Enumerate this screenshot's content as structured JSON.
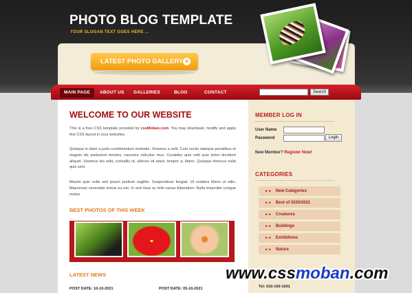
{
  "header": {
    "title": "PHOTO BLOG TEMPLATE",
    "slogan": "YOUR SLOGAN TEXT GOES HERE ..."
  },
  "banner": {
    "gallery_button": "LATEST PHOTO GALLERY"
  },
  "nav": {
    "items": [
      "MAIN PAGE",
      "ABOUT US",
      "GALLERIES",
      "BLOG",
      "CONTACT"
    ],
    "active_index": 0
  },
  "search": {
    "value": "",
    "button": "Search"
  },
  "main": {
    "welcome_title": "WELCOME TO OUR WEBSITE",
    "intro_before": "This is a free CSS template provided by ",
    "intro_link": "cssMoban.com",
    "intro_after": ". You may download, modify and apply this CSS layout in your websites.",
    "para2": "Quisque in diam a justo condimentum molestie. Vivamus a velit. Cum sociis natoque penatibus et magnis dis parturient montes, nascetur ridiculus mus. Curabitur quis velit quis tortor tincidunt aliquet. Vivamus leo velit, convallis id, ultrices sit amet, tempor a, libero. Quisque rhoncus nulla quis sem.",
    "para3": "Mauris quis nulla sed ipsum pretium sagittis. Suspendisse feugiat. Ut sodales libero ut odio. Maecenas venenatis metus eu est. In sed risus ac felis varius bibendum. Nulla imperdiet congue metus.",
    "best_photos_title": "BEST PHOTOS OF THIS WEEK",
    "latest_news_title": "LATEST NEWS",
    "news_dates": [
      "POST DATE: 10-10-2021",
      "POST DATE: 05-10-2021"
    ]
  },
  "sidebar": {
    "login_title": "MEMBER LOG IN",
    "username_label": "User Name",
    "password_label": "Password",
    "login_button": "Login",
    "new_member_text": "New Member? ",
    "register_link": "Register Now!",
    "categories_title": "CATEGORIES",
    "categories": [
      "New Categories",
      "Best of 2020/2021",
      "Creatures",
      "Buildings",
      "Exhibitions",
      "Nature"
    ],
    "tel": "Tel: 010-100-1001"
  },
  "watermark": {
    "part1": "www.css",
    "part2": "moban",
    "part3": ".com"
  },
  "colors": {
    "nav_red": "#c8151d",
    "accent_orange": "#f39b0c",
    "title_red": "#a30d11",
    "watermark_blue": "#1b3cc8"
  }
}
